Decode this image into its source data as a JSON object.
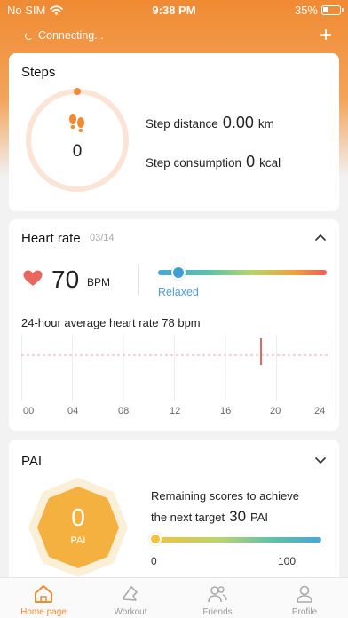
{
  "status_bar": {
    "carrier": "No SIM",
    "time": "9:38 PM",
    "battery": "35%",
    "battery_level": 0.35
  },
  "topbar": {
    "connection_status": "Connecting...",
    "add_label": "+"
  },
  "steps": {
    "title": "Steps",
    "count": "0",
    "distance_label": "Step distance",
    "distance_value": "0.00",
    "distance_unit": "km",
    "consumption_label": "Step consumption",
    "consumption_value": "0",
    "consumption_unit": "kcal"
  },
  "heart_rate": {
    "title": "Heart rate",
    "date": "03/14",
    "value": "70",
    "unit": "BPM",
    "zone": "Relaxed",
    "zone_position": 0.12,
    "average_text": "24-hour average heart rate 78 bpm",
    "chart_ticks": [
      "00",
      "04",
      "08",
      "12",
      "16",
      "20",
      "24"
    ]
  },
  "pai": {
    "title": "PAI",
    "value": "0",
    "value_label": "PAI",
    "remaining_line1": "Remaining scores to achieve",
    "remaining_line2": "the next target",
    "remaining_value": "30",
    "remaining_unit": "PAI",
    "scale_min": "0",
    "scale_max": "100",
    "progress": 0
  },
  "tabs": [
    {
      "label": "Home page",
      "icon": "home-icon",
      "active": true
    },
    {
      "label": "Workout",
      "icon": "shoe-icon",
      "active": false
    },
    {
      "label": "Friends",
      "icon": "friends-icon",
      "active": false
    },
    {
      "label": "Profile",
      "icon": "profile-icon",
      "active": false
    }
  ],
  "colors": {
    "accent": "#f08a33",
    "relaxed": "#4a9fd6",
    "pai": "#f4b13f",
    "heart": "#e8685f"
  }
}
